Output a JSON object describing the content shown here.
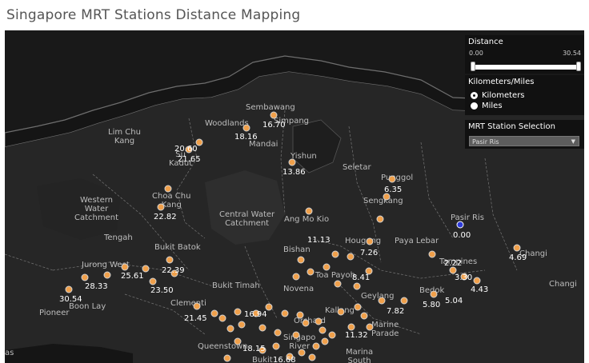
{
  "title": "Singapore MRT Stations Distance Mapping",
  "distance_filter": {
    "label": "Distance",
    "min": "0.00",
    "max": "30.54"
  },
  "units_filter": {
    "label": "Kilometers/Miles",
    "options": [
      "Kilometers",
      "Miles"
    ],
    "selected": "Kilometers"
  },
  "station_filter": {
    "label": "MRT Station Selection",
    "value": "Pasir Ris"
  },
  "map_labels": {
    "sembawang": "Sembawang",
    "woodlands": "Woodlands",
    "simpang": "Simpang",
    "mandai": "Mandai",
    "lim_chu_kang": "Lim Chu\nKang",
    "sungei_kadut": "Su\nKadut",
    "yishun": "Yishun",
    "seletar": "Seletar",
    "punggol": "Punggol",
    "sengkang": "Sengkang",
    "western_water": "Western\nWater\nCatchment",
    "choa_chu_kang": "Choa Chu\nKang",
    "central_water": "Central Water\nCatchment",
    "ang_mo_kio": "Ang Mo Kio",
    "pasir_ris": "Pasir Ris",
    "tengah": "Tengah",
    "bukit_batok": "Bukit Batok",
    "bishan": "Bishan",
    "hougang": "Hougang",
    "paya_lebar": "Paya Lebar",
    "jurong_west": "Jurong West",
    "tampines": "Tampines",
    "changi": "Changi",
    "changi_east": "Changi",
    "bukit_timah": "Bukit Timah",
    "novena": "Novena",
    "toa_payoh": "Toa Payoh",
    "bedok": "Bedok",
    "geylang": "Geylang",
    "clementi": "Clementi",
    "pioneer": "Pioneer",
    "boon_lay": "Boon Lay",
    "kallang": "Kallang",
    "orchard": "Orchard",
    "marine_parade": "Marine\nParade",
    "queenstown": "Queenstown",
    "singapore_river": "Singapo\nRiver",
    "marina_south": "Marina\nSouth",
    "bukit_merah": "Bukit",
    "tuas": "as"
  },
  "distances": [
    {
      "id": "d1",
      "value": "16.70"
    },
    {
      "id": "d2",
      "value": "18.16"
    },
    {
      "id": "d3",
      "value": "20.60"
    },
    {
      "id": "d4",
      "value": "21.65"
    },
    {
      "id": "d5",
      "value": "13.86"
    },
    {
      "id": "d6",
      "value": "6.35"
    },
    {
      "id": "d7",
      "value": "22.82"
    },
    {
      "id": "d8",
      "value": "0.00"
    },
    {
      "id": "d9",
      "value": "11.13"
    },
    {
      "id": "d10",
      "value": "7.26"
    },
    {
      "id": "d11",
      "value": "2.22"
    },
    {
      "id": "d12",
      "value": "4.69"
    },
    {
      "id": "d13",
      "value": "25.61"
    },
    {
      "id": "d14",
      "value": "22.39"
    },
    {
      "id": "d15",
      "value": "28.33"
    },
    {
      "id": "d16",
      "value": "23.50"
    },
    {
      "id": "d17",
      "value": "8.41"
    },
    {
      "id": "d18",
      "value": "3.30"
    },
    {
      "id": "d19",
      "value": "4.43"
    },
    {
      "id": "d20",
      "value": "30.54"
    },
    {
      "id": "d21",
      "value": "5.80"
    },
    {
      "id": "d22",
      "value": "5.04"
    },
    {
      "id": "d23",
      "value": "7.82"
    },
    {
      "id": "d24",
      "value": "21.45"
    },
    {
      "id": "d25",
      "value": "16.94"
    },
    {
      "id": "d26",
      "value": "11.32"
    },
    {
      "id": "d27",
      "value": "18.15"
    },
    {
      "id": "d28",
      "value": "16.68"
    }
  ],
  "colors": {
    "map_bg": "#1d1d1d",
    "water_outline": "#6e6e6e",
    "station_dot": "#f0a04b",
    "selected_dot": "#2d3bd8"
  }
}
